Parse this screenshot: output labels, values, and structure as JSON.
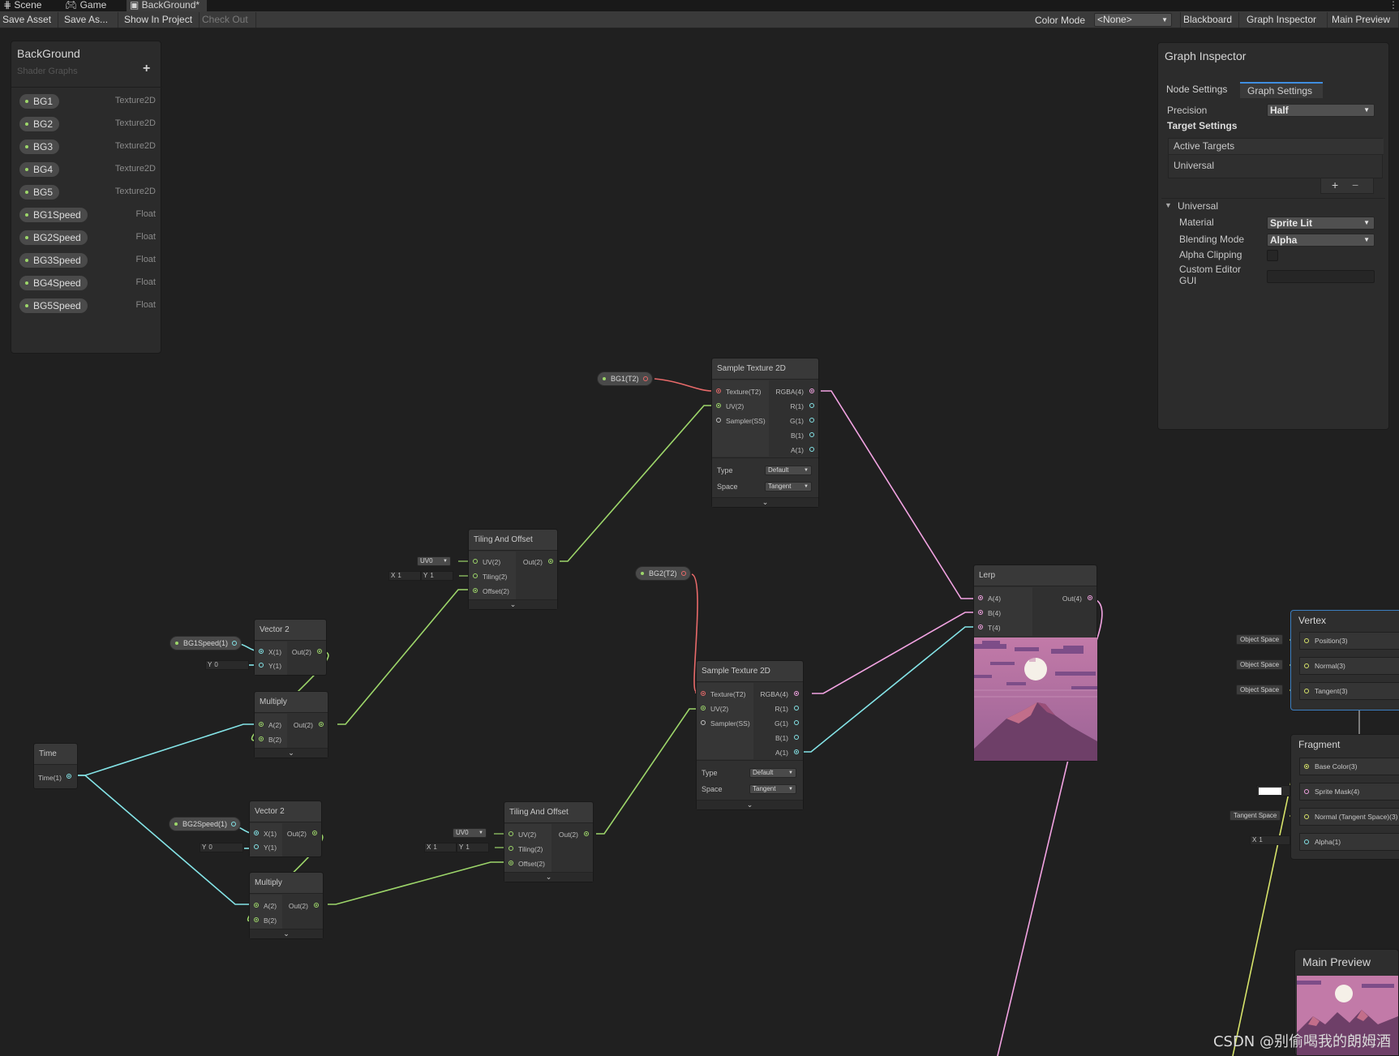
{
  "tabs": [
    {
      "label": "Scene",
      "icon": "grid-icon"
    },
    {
      "label": "Game",
      "icon": "gamepad-icon"
    },
    {
      "label": "BackGround*",
      "icon": "shader-graph-icon"
    }
  ],
  "toolbar": {
    "save_asset": "Save Asset",
    "save_as": "Save As...",
    "show_in_project": "Show In Project",
    "check_out": "Check Out",
    "color_mode_label": "Color Mode",
    "color_mode_value": "<None>",
    "blackboard": "Blackboard",
    "graph_inspector": "Graph Inspector",
    "main_preview": "Main Preview"
  },
  "blackboard": {
    "title": "BackGround",
    "subtitle": "Shader Graphs",
    "add_symbol": "+",
    "properties": [
      {
        "name": "BG1",
        "type": "Texture2D"
      },
      {
        "name": "BG2",
        "type": "Texture2D"
      },
      {
        "name": "BG3",
        "type": "Texture2D"
      },
      {
        "name": "BG4",
        "type": "Texture2D"
      },
      {
        "name": "BG5",
        "type": "Texture2D"
      },
      {
        "name": "BG1Speed",
        "type": "Float"
      },
      {
        "name": "BG2Speed",
        "type": "Float"
      },
      {
        "name": "BG3Speed",
        "type": "Float"
      },
      {
        "name": "BG4Speed",
        "type": "Float"
      },
      {
        "name": "BG5Speed",
        "type": "Float"
      }
    ]
  },
  "inspector": {
    "title": "Graph Inspector",
    "tabs": [
      "Node Settings",
      "Graph Settings"
    ],
    "precision_label": "Precision",
    "precision_value": "Half",
    "target_settings": "Target Settings",
    "active_targets": "Active Targets",
    "target_item": "Universal",
    "plus": "+",
    "minus": "−",
    "section": "Universal",
    "material_label": "Material",
    "material_value": "Sprite Lit",
    "blending_label": "Blending Mode",
    "blending_value": "Alpha",
    "alpha_clipping_label": "Alpha Clipping",
    "custom_editor_label": "Custom Editor GUI"
  },
  "nodes": {
    "sample1": {
      "title": "Sample Texture 2D",
      "type_label": "Type",
      "type_value": "Default",
      "space_label": "Space",
      "space_value": "Tangent",
      "inputs": [
        "Texture(T2)",
        "UV(2)",
        "Sampler(SS)"
      ],
      "outputs": [
        "RGBA(4)",
        "R(1)",
        "G(1)",
        "B(1)",
        "A(1)"
      ]
    },
    "sample2": {
      "title": "Sample Texture 2D",
      "type_label": "Type",
      "type_value": "Default",
      "space_label": "Space",
      "space_value": "Tangent",
      "inputs": [
        "Texture(T2)",
        "UV(2)",
        "Sampler(SS)"
      ],
      "outputs": [
        "RGBA(4)",
        "R(1)",
        "G(1)",
        "B(1)",
        "A(1)"
      ]
    },
    "tiling1": {
      "title": "Tiling And Offset",
      "inputs": [
        "UV(2)",
        "Tiling(2)",
        "Offset(2)"
      ],
      "output": "Out(2)"
    },
    "tiling2": {
      "title": "Tiling And Offset",
      "inputs": [
        "UV(2)",
        "Tiling(2)",
        "Offset(2)"
      ],
      "output": "Out(2)"
    },
    "vector1": {
      "title": "Vector 2",
      "inputs": [
        "X(1)",
        "Y(1)"
      ],
      "output": "Out(2)"
    },
    "vector2": {
      "title": "Vector 2",
      "inputs": [
        "X(1)",
        "Y(1)"
      ],
      "output": "Out(2)"
    },
    "multiply1": {
      "title": "Multiply",
      "inputs": [
        "A(2)",
        "B(2)"
      ],
      "output": "Out(2)"
    },
    "multiply2": {
      "title": "Multiply",
      "inputs": [
        "A(2)",
        "B(2)"
      ],
      "output": "Out(2)"
    },
    "time": {
      "title": "Time",
      "output": "Time(1)"
    },
    "lerp": {
      "title": "Lerp",
      "inputs": [
        "A(4)",
        "B(4)",
        "T(4)"
      ],
      "output": "Out(4)"
    }
  },
  "pills": {
    "bg1": "BG1(T2)",
    "bg2": "BG2(T2)",
    "bg1speed": "BG1Speed(1)",
    "bg2speed": "BG2Speed(1)"
  },
  "fields": {
    "uv0": "UV0",
    "x_lab": "X",
    "y_lab": "Y",
    "one": "1",
    "zero": "0"
  },
  "vertex": {
    "title": "Vertex",
    "blocks": [
      "Position(3)",
      "Normal(3)",
      "Tangent(3)"
    ],
    "space": "Object Space"
  },
  "fragment": {
    "title": "Fragment",
    "blocks": [
      "Base Color(3)",
      "Sprite Mask(4)",
      "Normal (Tangent Space)(3)",
      "Alpha(1)"
    ],
    "normal_space": "Tangent Space",
    "alpha_x": "X",
    "alpha_value": "1"
  },
  "main_preview": {
    "title": "Main Preview"
  },
  "watermark": "CSDN @别偷喝我的朗姆酒",
  "colors": {
    "texture_port": "#e86a6a",
    "vector2_port": "#9dd66a",
    "vector4_port": "#f2a3e2",
    "float_port": "#84e4e7",
    "sampler_port": "#bfbfbf",
    "accent": "#3f8ee0"
  }
}
